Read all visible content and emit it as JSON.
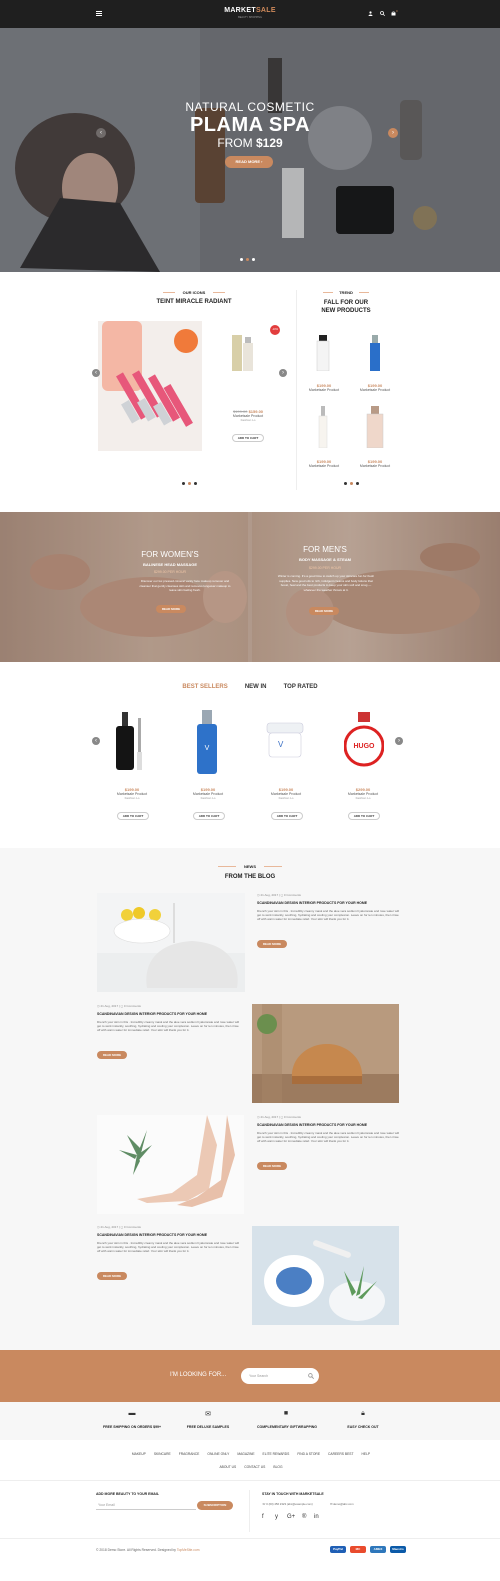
{
  "header": {
    "logo_main": "MARKET",
    "logo_accent": "SALE",
    "tagline": "BEAUTY SHOPPING",
    "menu_icon": "menu-icon",
    "icons": [
      "user-icon",
      "search-icon",
      "cart-icon"
    ],
    "cart_count": "0"
  },
  "hero": {
    "subtitle": "NATURAL COSMETIC",
    "title": "PLAMA SPA",
    "from_text": "FROM",
    "price": "$129",
    "button": "READ MORE",
    "prev_icon": "‹",
    "next_icon": "›"
  },
  "icons_section": {
    "tag": "OUR ICONS",
    "title": "TEINT MIRACLE RADIANT",
    "badge": "-10%",
    "old_price": "$199.00",
    "price": "$159.00",
    "product_name": "Marketsale Product",
    "brand": "Fashion Lo",
    "add_to_cart": "ADD TO CART"
  },
  "trend_section": {
    "tag": "TREND",
    "title_line1": "FALL FOR OUR",
    "title_line2": "NEW PRODUCTS",
    "products": [
      {
        "price": "$199.00",
        "name": "Marketsale Product"
      },
      {
        "price": "$199.00",
        "name": "Marketsale Product"
      },
      {
        "price": "$199.00",
        "name": "Marketsale Product"
      },
      {
        "price": "$199.00",
        "name": "Marketsale Product"
      }
    ]
  },
  "massage": {
    "women": {
      "title": "FOR WOMEN'S",
      "subtitle": "BALINESE HEAD MASSAGE",
      "price": "$299.00 PER HOUR",
      "text": "Discover our lux pressed-mineral vanity face makeup remover and cleanser that gently cleanses skin and removes longwear makeup to leave skin feeling fresh.",
      "button": "READ MORE"
    },
    "men": {
      "title": "FOR MEN'S",
      "subtitle": "BODY MASSAGE & STEAM",
      "price": "$299.00 PER HOUR",
      "text": "Winter is coming. It's a good time to switch up your skincare fun for fresh supplies. New good oils to rich, indulgent creams and body lotions that boost, heal and the best products to keep your skin soft and snug — whatever the weather throws at it.",
      "button": "READ MORE"
    }
  },
  "product_tabs": {
    "tabs": [
      "BEST SELLERS",
      "NEW IN",
      "TOP RATED"
    ],
    "products": [
      {
        "price": "$199.00",
        "name": "Marketsale Product",
        "brand": "Fashion Lo",
        "button": "ADD TO CART"
      },
      {
        "price": "$199.00",
        "name": "Marketsale Product",
        "brand": "Fashion Lo",
        "button": "ADD TO CART"
      },
      {
        "price": "$199.00",
        "name": "Marketsale Product",
        "brand": "Fashion Lo",
        "button": "ADD TO CART"
      },
      {
        "price": "$299.00",
        "name": "Marketsale Product",
        "brand": "Fashion Lo",
        "button": "ADD TO CART"
      }
    ]
  },
  "blog": {
    "tag": "NEWS",
    "title": "FROM THE BLOG",
    "posts": [
      {
        "date": "21 Aug, 2017",
        "comments": "0 Comments",
        "title": "SCANDINAVIAN DESIGN INTERIOR PRODUCTS FOR YOUR HOME",
        "text": "Drench your skin in this . Incredibly creamy mask and the aloe vera sodium hyaluronate and rose water will get to work instantly, soothing, hydrating and cooling your complexion. Leave on for ten minutes, then rinse off with warm water for immediate relief. Your skin will thank you for it.",
        "button": "READ MORE"
      },
      {
        "date": "21 Aug, 2017",
        "comments": "0 Comments",
        "title": "SCANDINAVIAN DESIGN INTERIOR PRODUCTS FOR YOUR HOME",
        "text": "Drench your skin in this . Incredibly creamy mask and the aloe vera sodium hyaluronate and rose water will get to work instantly, soothing, hydrating and cooling your complexion. Leave on for ten minutes, then rinse off with warm water for immediate relief. Your skin will thank you for it.",
        "button": "READ MORE"
      },
      {
        "date": "21 Aug, 2017",
        "comments": "0 Comments",
        "title": "SCANDINAVIAN DESIGN INTERIOR PRODUCTS FOR YOUR HOME",
        "text": "Drench your skin in this . Incredibly creamy mask and the aloe vera sodium hyaluronate and rose water will get to work instantly, soothing, hydrating and cooling your complexion. Leave on for ten minutes, then rinse off with warm water for immediate relief. Your skin will thank you for it.",
        "button": "READ MORE"
      },
      {
        "date": "21 Aug, 2017",
        "comments": "0 Comments",
        "title": "SCANDINAVIAN DESIGN INTERIOR PRODUCTS FOR YOUR HOME",
        "text": "Drench your skin in this . Incredibly creamy mask and the aloe vera sodium hyaluronate and rose water will get to work instantly, soothing, hydrating and cooling your complexion. Leave on for ten minutes, then rinse off with warm water for immediate relief. Your skin will thank you for it.",
        "button": "READ MORE"
      }
    ]
  },
  "search_band": {
    "label": "I'M LOOKING FOR...",
    "placeholder": "Your Search",
    "icon": "search-icon"
  },
  "features": [
    {
      "icon": "truck-icon",
      "label": "FREE SHIPPING ON ORDERS $99+"
    },
    {
      "icon": "gift-icon",
      "label": "FREE DELUXE SAMPLES"
    },
    {
      "icon": "box-icon",
      "label": "COMPLEMENTARY GIFTWRAPPING"
    },
    {
      "icon": "lock-icon",
      "label": "EASY CHECK OUT"
    }
  ],
  "footer_nav": {
    "row1": [
      "MAKEUP",
      "SKINCARE",
      "FRAGRANCE",
      "ONLINE ONLY",
      "MAGAZINE",
      "ELITE REWARDS",
      "FIND A STORE",
      "CAREERS BEST",
      "HELP"
    ],
    "row2": [
      "ABOUT US",
      "CONTACT US",
      "BLOG"
    ]
  },
  "newsletter": {
    "heading": "ADD MORE BEAUTY TO YOUR EMAIL",
    "placeholder": "Your Email",
    "button": "SUBSCRIPTION"
  },
  "contact": {
    "heading": "STAY IN TOUCH WITH MARKETSALE",
    "phone": "0 (00) 456 2323 (abc@example.com)",
    "email": "demo@abc.com",
    "social": [
      "f",
      "y",
      "G+",
      "®",
      "in"
    ]
  },
  "copyright": {
    "text": "© 2018 Demo Store. All Rights Reserved. Designed by ",
    "link": "TopMeSite.com"
  },
  "payments": [
    "PayPal",
    "MC",
    "AMEX",
    "Maestro"
  ],
  "colors": {
    "accent": "#c9895f",
    "header": "#1f1f1f"
  }
}
